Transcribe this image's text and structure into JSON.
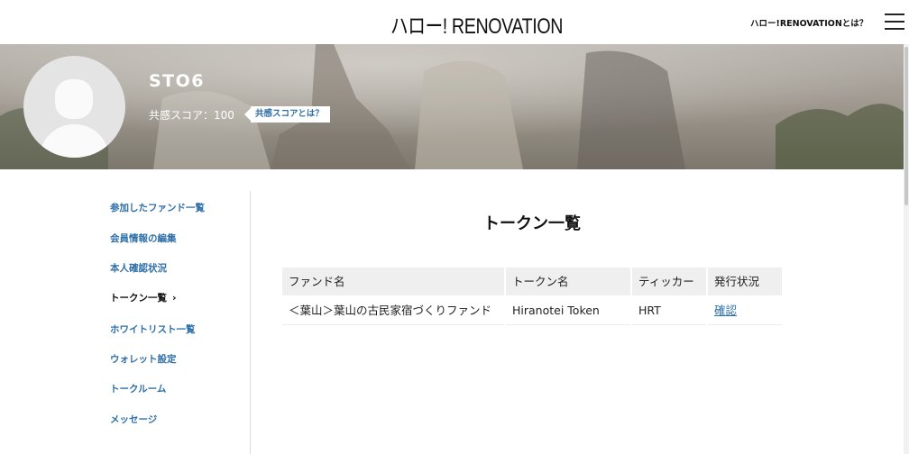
{
  "header": {
    "logo_text": "ハロー! RENOVATION",
    "about_link": "ハロー!RENOVATIONとは？",
    "menu_icon": "hamburger-icon"
  },
  "profile": {
    "username": "STO6",
    "score_label": "共感スコア：100",
    "score_help": "共感スコアとは？",
    "avatar_icon": "default-user-avatar"
  },
  "sidebar": {
    "items": [
      {
        "label": "参加したファンド一覧"
      },
      {
        "label": "会員情報の編集"
      },
      {
        "label": "本人確認状況"
      },
      {
        "label": "トークン一覧",
        "active": true
      },
      {
        "label": "ホワイトリスト一覧"
      },
      {
        "label": "ウォレット設定"
      },
      {
        "label": "トークルーム"
      },
      {
        "label": "メッセージ"
      }
    ],
    "active_chevron": "›"
  },
  "main": {
    "title": "トークン一覧",
    "table": {
      "headers": [
        "ファンド名",
        "トークン名",
        "ティッカー",
        "発行状況"
      ],
      "rows": [
        {
          "fund": "＜葉山＞葉山の古民家宿づくりファンド",
          "token": "Hiranotei Token",
          "ticker": "HRT",
          "status": "確認"
        }
      ]
    }
  },
  "colors": {
    "link": "#2d6fa8",
    "header_bg": "#efefef"
  }
}
